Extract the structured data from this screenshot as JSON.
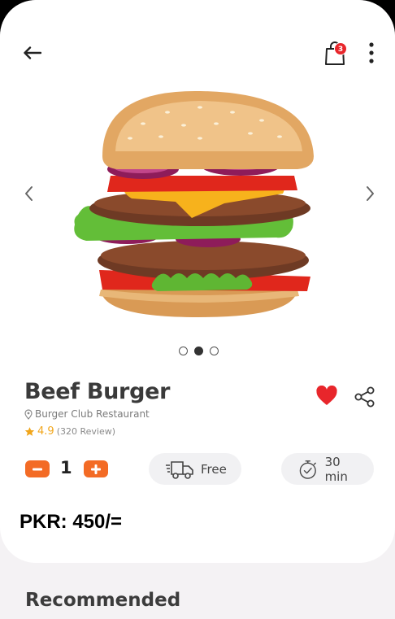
{
  "header": {
    "cart_count": "3"
  },
  "product": {
    "name": "Beef Burger",
    "restaurant": "Burger Club Restaurant",
    "rating": "4.9",
    "reviews": "(320 Review)",
    "favorited": true
  },
  "carousel": {
    "total": 3,
    "active_index": 1
  },
  "order": {
    "quantity": "1",
    "delivery": "Free",
    "time": "30 min",
    "price": "PKR: 450/="
  },
  "sections": {
    "recommended": "Recommended"
  },
  "colors": {
    "accent": "#f36b25",
    "heart": "#e8262b",
    "star": "#f1a61c"
  },
  "icons": [
    "arrow-left-icon",
    "shopping-bag-icon",
    "more-vertical-icon",
    "chevron-left-icon",
    "chevron-right-icon",
    "heart-icon",
    "share-icon",
    "location-pin-icon",
    "star-icon",
    "minus-icon",
    "plus-icon",
    "delivery-truck-icon",
    "stopwatch-icon"
  ]
}
